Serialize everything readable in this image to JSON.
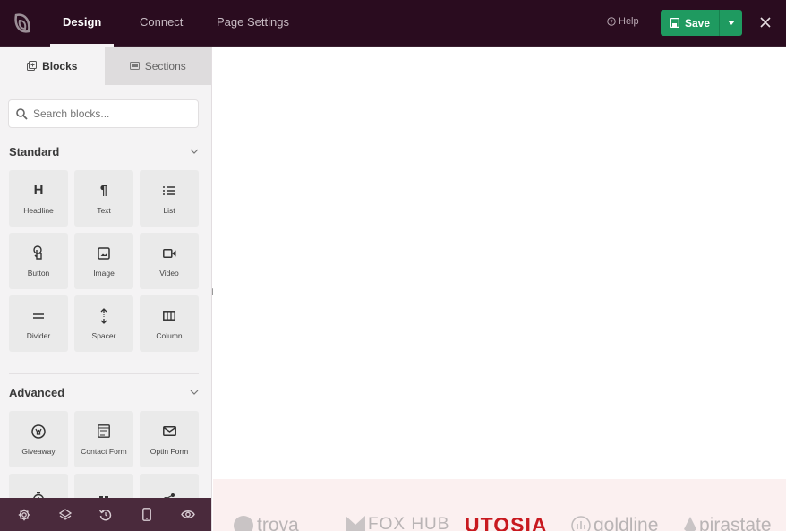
{
  "header": {
    "tabs": [
      {
        "label": "Design",
        "active": true
      },
      {
        "label": "Connect",
        "active": false
      },
      {
        "label": "Page Settings",
        "active": false
      }
    ],
    "help_label": "Help",
    "save_label": "Save",
    "accent_color": "#1f9a60",
    "bar_color": "#2a0c1f"
  },
  "sidebar": {
    "tabs": [
      {
        "label": "Blocks",
        "icon": "blocks-icon",
        "active": true
      },
      {
        "label": "Sections",
        "icon": "sections-icon",
        "active": false
      }
    ],
    "search": {
      "placeholder": "Search blocks...",
      "value": ""
    },
    "standard": {
      "title": "Standard",
      "blocks": [
        {
          "label": "Headline",
          "icon": "headline-icon"
        },
        {
          "label": "Text",
          "icon": "paragraph-icon"
        },
        {
          "label": "List",
          "icon": "list-icon"
        },
        {
          "label": "Button",
          "icon": "button-pointer-icon"
        },
        {
          "label": "Image",
          "icon": "image-icon"
        },
        {
          "label": "Video",
          "icon": "video-icon"
        },
        {
          "label": "Divider",
          "icon": "divider-icon"
        },
        {
          "label": "Spacer",
          "icon": "spacer-icon"
        },
        {
          "label": "Column",
          "icon": "column-icon"
        }
      ]
    },
    "advanced": {
      "title": "Advanced",
      "blocks": [
        {
          "label": "Giveaway",
          "icon": "giveaway-icon"
        },
        {
          "label": "Contact Form",
          "icon": "contact-form-icon"
        },
        {
          "label": "Optin Form",
          "icon": "envelope-icon"
        },
        {
          "label": "",
          "icon": "countdown-icon"
        },
        {
          "label": "",
          "icon": "block-icon"
        },
        {
          "label": "",
          "icon": "share-icon"
        }
      ]
    },
    "bottom_bar": [
      "settings-icon",
      "layers-icon",
      "history-icon",
      "mobile-preview-icon",
      "preview-eye-icon"
    ]
  },
  "canvas": {
    "logos": [
      "trova",
      "FOX HUB",
      "UTOSIA",
      "goldline",
      "pirastate"
    ]
  }
}
